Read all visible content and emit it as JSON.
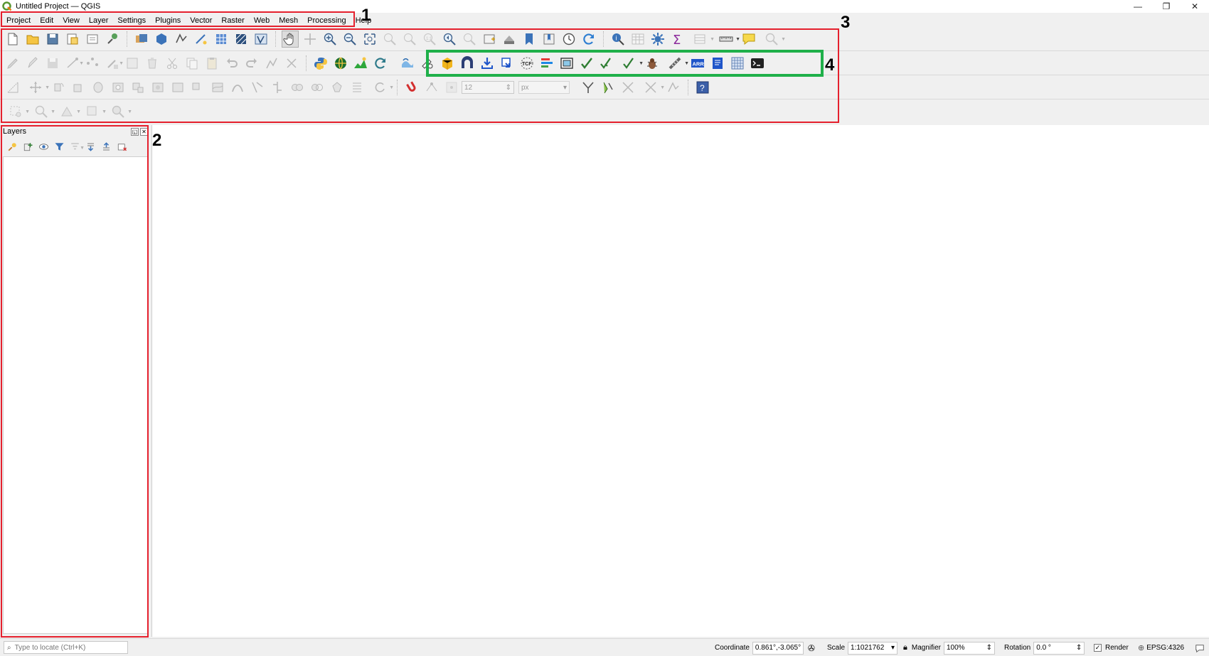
{
  "window": {
    "title": "Untitled Project — QGIS",
    "controls": [
      "minimize",
      "restore",
      "close"
    ]
  },
  "menubar": {
    "items": [
      "Project",
      "Edit",
      "View",
      "Layer",
      "Settings",
      "Plugins",
      "Vector",
      "Raster",
      "Web",
      "Mesh",
      "Processing",
      "Help"
    ]
  },
  "toolbar": {
    "snapping_tolerance": "12",
    "snapping_unit": "px",
    "help_label": "?",
    "plugin_labels": {
      "tcf": "TCF",
      "arr": "ARR"
    }
  },
  "layers_panel": {
    "title": "Layers",
    "float_button": "◱",
    "close_button": "✕"
  },
  "statusbar": {
    "locator_placeholder": "Type to locate (Ctrl+K)",
    "coordinate_label": "Coordinate",
    "coordinate_value": "0.861°,-3.065°",
    "scale_label": "Scale",
    "scale_value": "1:1021762",
    "magnifier_label": "Magnifier",
    "magnifier_value": "100%",
    "rotation_label": "Rotation",
    "rotation_value": "0.0 °",
    "render_label": "Render",
    "render_checked": true,
    "crs_label": "EPSG:4326"
  },
  "annotations": {
    "label_1": "1",
    "label_2": "2",
    "label_3": "3",
    "label_4": "4",
    "red_color": "#e5202d",
    "green_color": "#1fb04a"
  }
}
